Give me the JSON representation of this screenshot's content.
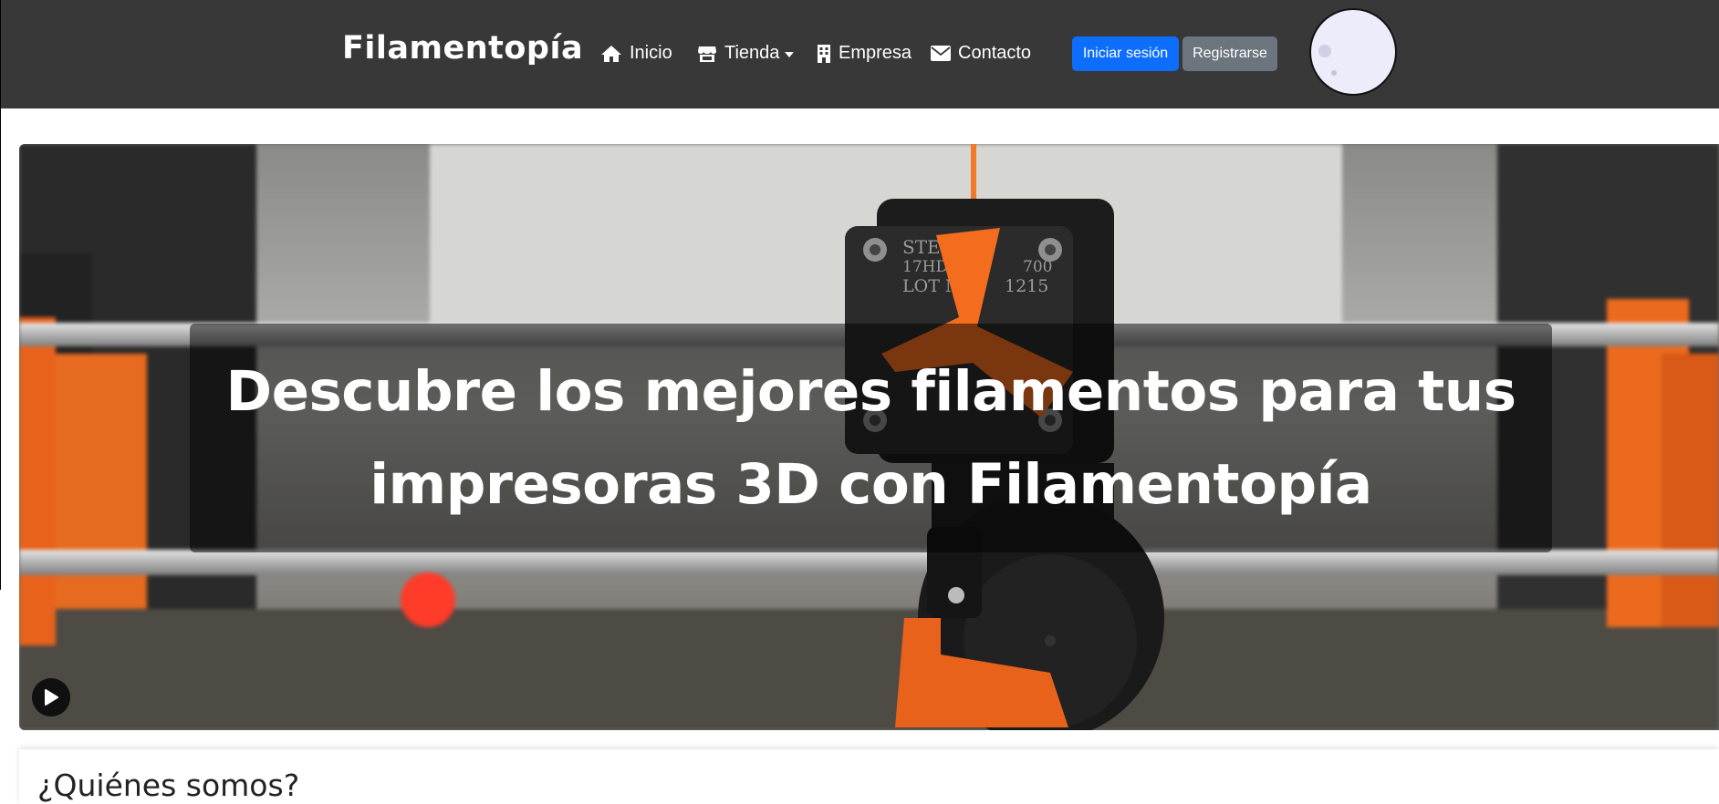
{
  "navbar": {
    "brand": "Filamentopía",
    "links": [
      {
        "label": "Inicio",
        "icon": "home-icon"
      },
      {
        "label": "Tienda",
        "icon": "store-icon"
      },
      {
        "label": "Empresa",
        "icon": "building-icon"
      },
      {
        "label": "Contacto",
        "icon": "envelope-icon"
      }
    ],
    "login_label": "Iniciar sesión",
    "register_label": "Registrarse"
  },
  "hero": {
    "headline": "Descubre los mejores filamentos para tus impresoras 3D con Filamentopía",
    "play_icon": "play-icon"
  },
  "about": {
    "heading": "¿Quiénes somos?"
  },
  "colors": {
    "navbar_bg": "#383838",
    "primary": "#0d6efd",
    "secondary": "#6c757d",
    "accent_orange": "#f26b1d"
  }
}
